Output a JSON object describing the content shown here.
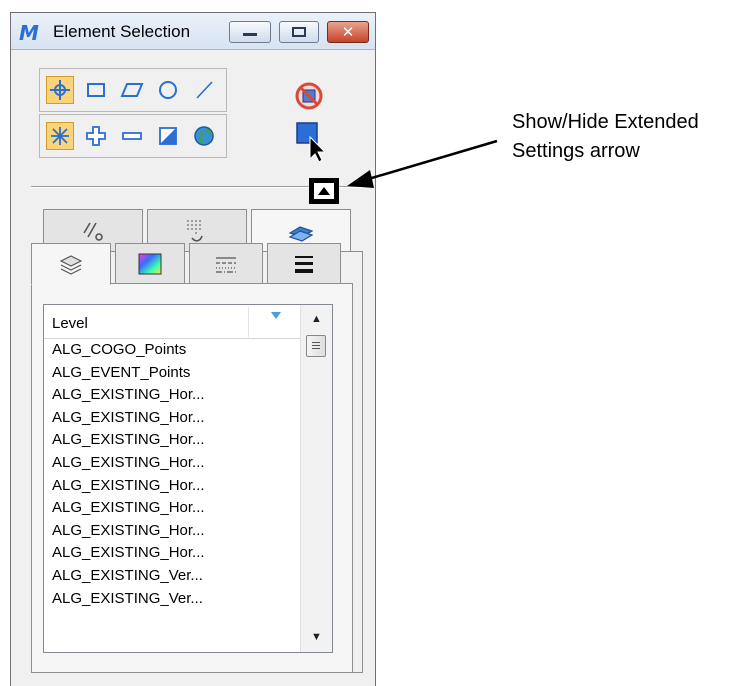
{
  "window": {
    "title": "Element Selection",
    "app_icon": "microstation-logo-icon",
    "controls": [
      "minimize-icon",
      "maximize-icon",
      "close-icon"
    ]
  },
  "toolbar": {
    "row1": [
      {
        "name": "individual-method-icon",
        "active": true
      },
      {
        "name": "block-method-icon",
        "active": false
      },
      {
        "name": "shape-method-icon",
        "active": false
      },
      {
        "name": "circle-method-icon",
        "active": false
      },
      {
        "name": "line-method-icon",
        "active": false
      }
    ],
    "row2": [
      {
        "name": "new-mode-icon",
        "active": true
      },
      {
        "name": "add-mode-icon",
        "active": false
      },
      {
        "name": "subtract-mode-icon",
        "active": false
      },
      {
        "name": "invert-mode-icon",
        "active": false
      },
      {
        "name": "select-all-icon",
        "active": false
      }
    ],
    "right": [
      "clear-selection-icon",
      "select-all-pointer-icon"
    ]
  },
  "extended_toggle": {
    "icon": "triangle-up-icon"
  },
  "tabs_back": [
    "line-style-tab-icon",
    "weight-tab-icon",
    "class-tab-icon"
  ],
  "tabs_front": [
    "levels-tab-icon",
    "color-tab-icon",
    "style-tab-icon",
    "weight-tab-icon"
  ],
  "list": {
    "column_header": "Level",
    "rows": [
      "ALG_COGO_Points",
      "ALG_EVENT_Points",
      "ALG_EXISTING_Hor...",
      "ALG_EXISTING_Hor...",
      "ALG_EXISTING_Hor...",
      "ALG_EXISTING_Hor...",
      "ALG_EXISTING_Hor...",
      "ALG_EXISTING_Hor...",
      "ALG_EXISTING_Hor...",
      "ALG_EXISTING_Hor...",
      "ALG_EXISTING_Ver...",
      "ALG_EXISTING_Ver..."
    ]
  },
  "callout": {
    "line1": "Show/Hide Extended",
    "line2": "Settings arrow"
  },
  "colors": {
    "active_tool": "#fbd37a",
    "close_button": "#c6442a"
  }
}
